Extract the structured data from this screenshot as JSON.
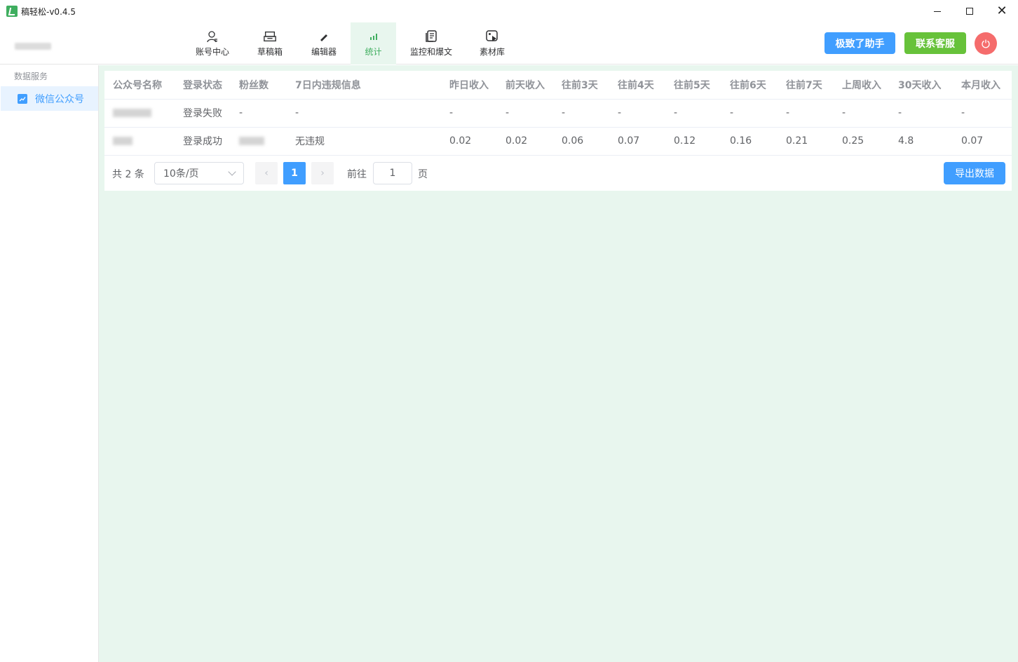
{
  "window": {
    "title": "稿轻松-v0.4.5"
  },
  "nav": [
    {
      "label": "账号中心",
      "icon": "user-icon"
    },
    {
      "label": "草稿箱",
      "icon": "inbox-icon"
    },
    {
      "label": "编辑器",
      "icon": "pen-icon"
    },
    {
      "label": "统计",
      "icon": "bar-chart-icon",
      "active": true
    },
    {
      "label": "监控和爆文",
      "icon": "document-icon"
    },
    {
      "label": "素材库",
      "icon": "media-icon"
    }
  ],
  "actions": {
    "helper": "极致了助手",
    "service": "联系客服"
  },
  "sidebar": {
    "group": "数据服务",
    "items": [
      {
        "label": "微信公众号"
      }
    ]
  },
  "table": {
    "columns": [
      "公众号名称",
      "登录状态",
      "粉丝数",
      "7日内违规信息",
      "昨日收入",
      "前天收入",
      "往前3天",
      "往前4天",
      "往前5天",
      "往前6天",
      "往前7天",
      "上周收入",
      "30天收入",
      "本月收入"
    ],
    "rows": [
      {
        "status": "登录失败",
        "violation": "-",
        "fans": "-",
        "values": [
          "-",
          "-",
          "-",
          "-",
          "-",
          "-",
          "-",
          "-",
          "-",
          "-"
        ]
      },
      {
        "status": "登录成功",
        "violation": "无违规",
        "fans": "",
        "values": [
          "0.02",
          "0.02",
          "0.06",
          "0.07",
          "0.12",
          "0.16",
          "0.21",
          "0.25",
          "4.8",
          "0.07"
        ]
      }
    ]
  },
  "pager": {
    "total": "共 2 条",
    "size": "10条/页",
    "current": "1",
    "goto_label": "前往",
    "goto_value": "1",
    "goto_suffix": "页",
    "export": "导出数据"
  },
  "colors": {
    "accent": "#409eff",
    "green": "#67c23a",
    "danger": "#f56c6c",
    "active_nav": "#3fae5f"
  }
}
